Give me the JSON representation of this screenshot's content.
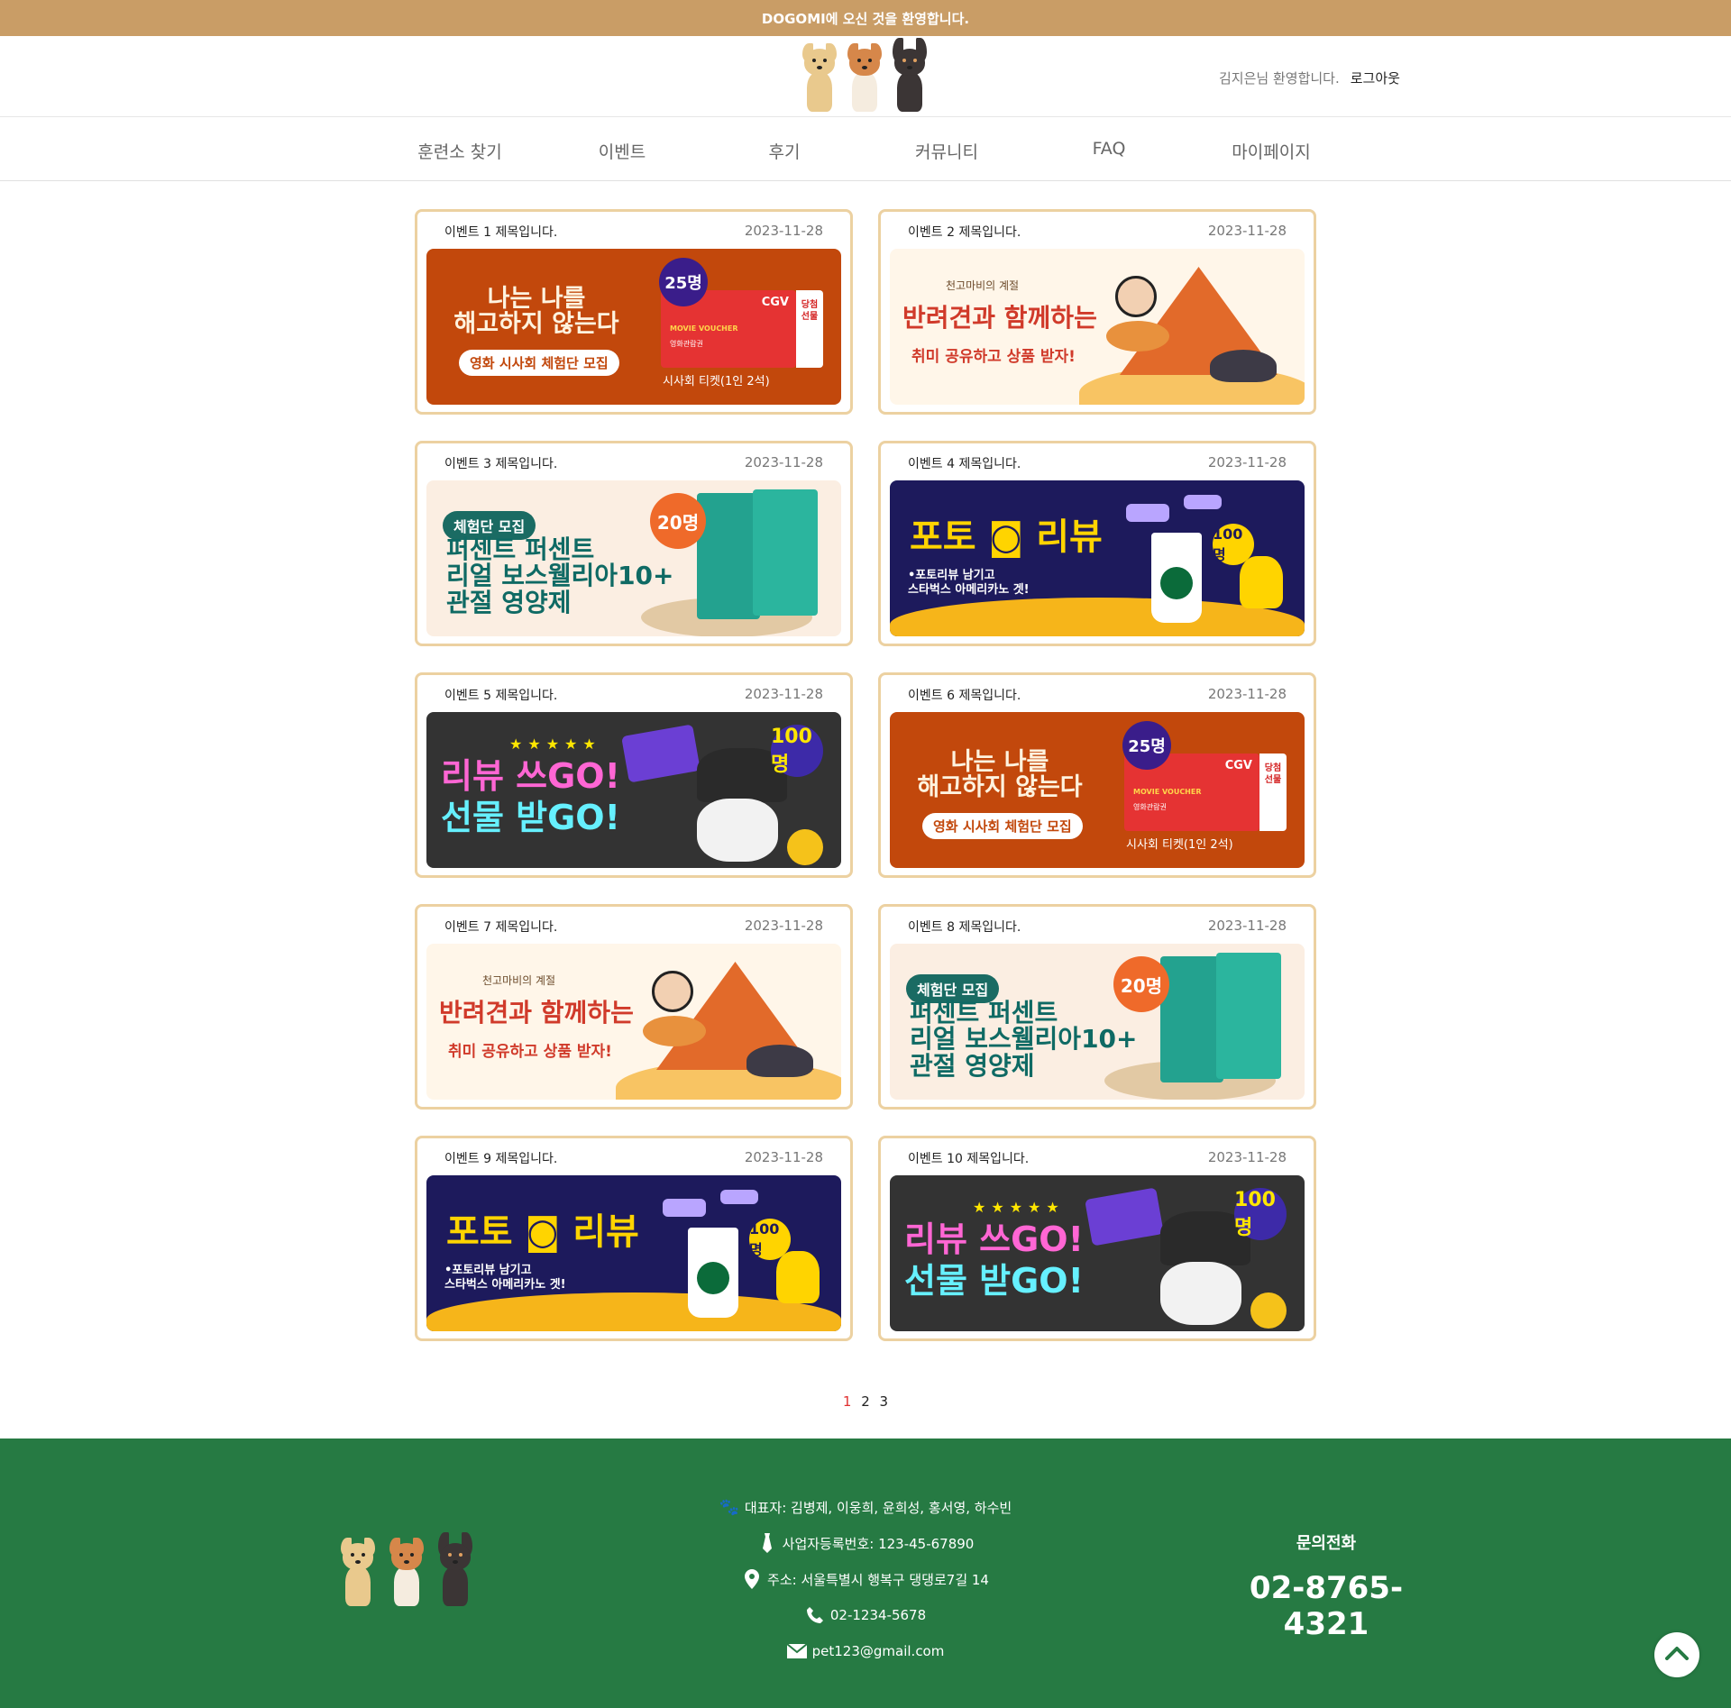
{
  "topbar": {
    "text": "DOGOMI에 오신 것을 환영합니다."
  },
  "header": {
    "greeting": "김지은님 환영합니다.",
    "logout": "로그아웃"
  },
  "nav": {
    "items": [
      {
        "label": "훈련소 찾기"
      },
      {
        "label": "이벤트"
      },
      {
        "label": "후기"
      },
      {
        "label": "커뮤니티"
      },
      {
        "label": "FAQ"
      },
      {
        "label": "마이페이지"
      }
    ]
  },
  "events": [
    {
      "title": "이벤트 1 제목입니다.",
      "date": "2023-11-28",
      "banner": "movie"
    },
    {
      "title": "이벤트 2 제목입니다.",
      "date": "2023-11-28",
      "banner": "autumn"
    },
    {
      "title": "이벤트 3 제목입니다.",
      "date": "2023-11-28",
      "banner": "supplement"
    },
    {
      "title": "이벤트 4 제목입니다.",
      "date": "2023-11-28",
      "banner": "photo"
    },
    {
      "title": "이벤트 5 제목입니다.",
      "date": "2023-11-28",
      "banner": "review"
    },
    {
      "title": "이벤트 6 제목입니다.",
      "date": "2023-11-28",
      "banner": "movie"
    },
    {
      "title": "이벤트 7 제목입니다.",
      "date": "2023-11-28",
      "banner": "autumn"
    },
    {
      "title": "이벤트 8 제목입니다.",
      "date": "2023-11-28",
      "banner": "supplement"
    },
    {
      "title": "이벤트 9 제목입니다.",
      "date": "2023-11-28",
      "banner": "photo"
    },
    {
      "title": "이벤트 10 제목입니다.",
      "date": "2023-11-28",
      "banner": "review"
    }
  ],
  "banners": {
    "movie": {
      "headline": "나는 나를\n해고하지 않는다",
      "pill": "영화 시사회 체험단 모집",
      "badge": "25명",
      "brand": "CGV",
      "voucher": "MOVIE VOUCHER",
      "voucher_sub": "영화관람권",
      "stub": "당첨\n선물",
      "caption": "시사회 티켓(1인 2석)"
    },
    "autumn": {
      "small": "천고마비의 계절",
      "headline": "반려견과 함께하는",
      "sub": "취미 공유하고 상품 받자!"
    },
    "supplement": {
      "pill": "체험단 모집",
      "headline": "퍼센트 퍼센트\n리얼 보스웰리아10+\n관절 영양제",
      "badge": "20명"
    },
    "photo": {
      "headline": "포토 ◙ 리뷰",
      "sub": "•포토리뷰 남기고\n스타벅스 아메리카노 겟!",
      "badge": "100명"
    },
    "review": {
      "stars": "★★★★★",
      "headline1": "리뷰 쓰GO!",
      "headline2": "선물 받GO!",
      "badge": "100명"
    }
  },
  "pagination": {
    "pages": [
      "1",
      "2",
      "3"
    ],
    "active": "1"
  },
  "footer": {
    "representative": "대표자: 김병제, 이웅희, 윤희성, 홍서영, 하수빈",
    "business_no": "사업자등록번호: 123-45-67890",
    "address": "주소: 서울특별시 행복구 댕댕로7길 14",
    "phone": "02-1234-5678",
    "email": "pet123@gmail.com",
    "contact_label": "문의전화",
    "contact_number": "02-8765-4321"
  },
  "colors": {
    "topbar": "#c99d66",
    "card_border": "#ecd1a1",
    "footer": "#267a43",
    "active_page": "#e03030"
  }
}
